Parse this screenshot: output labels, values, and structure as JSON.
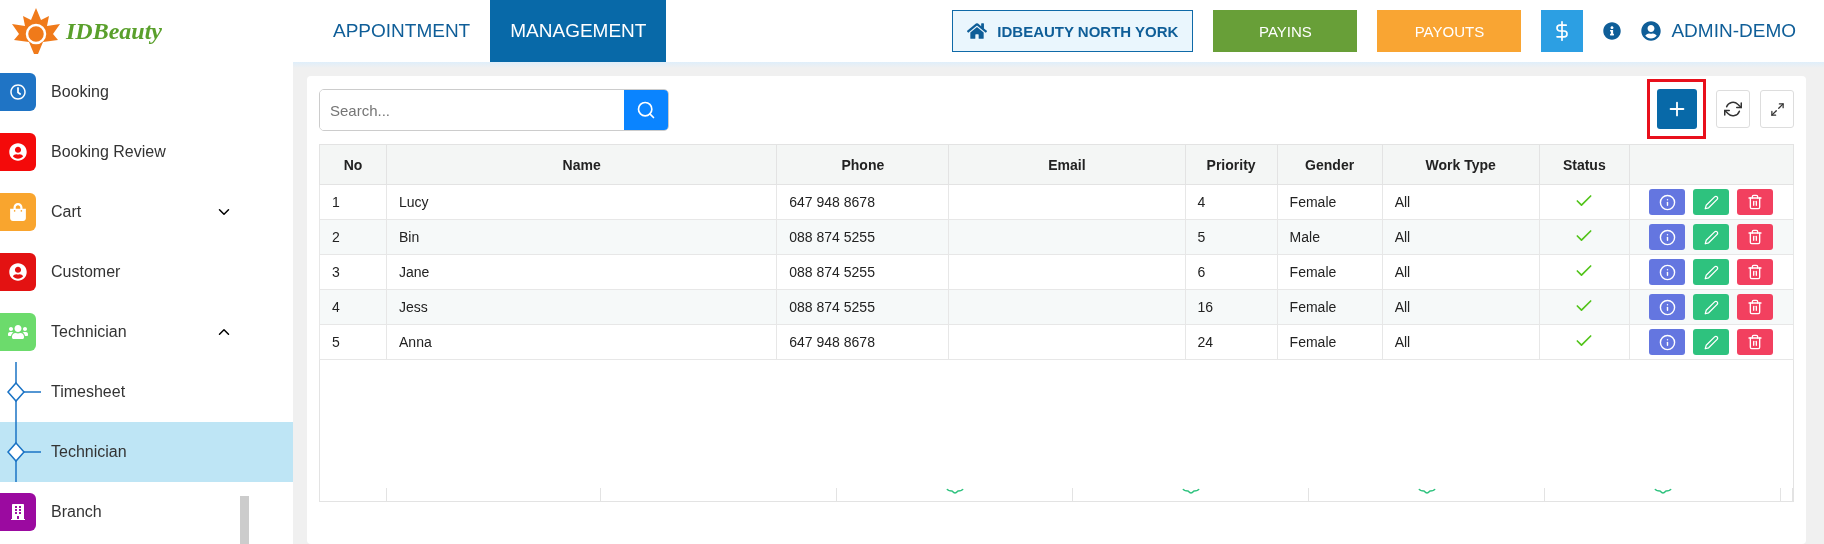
{
  "logo": {
    "text": "IDBeauty"
  },
  "nav_tabs": [
    {
      "label": "APPOINTMENT",
      "selected": false
    },
    {
      "label": "MANAGEMENT",
      "selected": true
    }
  ],
  "branch_button": "IDBEAUTY NORTH YORK",
  "action_buttons": [
    {
      "label": "PAYINS",
      "color": "#689f38"
    },
    {
      "label": "PAYOUTS",
      "color": "#f9a533"
    }
  ],
  "user": "ADMIN-DEMO",
  "sidebar": {
    "items": [
      {
        "label": "Booking",
        "color": "#1f74c5"
      },
      {
        "label": "Booking Review",
        "color": "#f40a0a"
      },
      {
        "label": "Cart",
        "color": "#f9a52e",
        "expanded": false
      },
      {
        "label": "Customer",
        "color": "#e31212"
      },
      {
        "label": "Technician",
        "color": "#6cdb6c",
        "expanded": true,
        "children": [
          {
            "label": "Timesheet",
            "selected": false
          },
          {
            "label": "Technician",
            "selected": true
          }
        ]
      },
      {
        "label": "Branch",
        "color": "#9b0aa0"
      }
    ]
  },
  "search": {
    "placeholder": "Search..."
  },
  "table": {
    "columns": [
      "No",
      "Name",
      "Phone",
      "Email",
      "Priority",
      "Gender",
      "Work Type",
      "Status"
    ],
    "rows": [
      {
        "no": "1",
        "name": "Lucy",
        "phone": "647 948 8678",
        "priority": "4",
        "gender": "Female",
        "work_type": "All",
        "status": true
      },
      {
        "no": "2",
        "name": "Bin",
        "phone": "088 874 5255",
        "priority": "5",
        "gender": "Male",
        "work_type": "All",
        "status": true
      },
      {
        "no": "3",
        "name": "Jane",
        "phone": "088 874 5255",
        "priority": "6",
        "gender": "Female",
        "work_type": "All",
        "status": true
      },
      {
        "no": "4",
        "name": "Jess",
        "phone": "088 874 5255",
        "priority": "16",
        "gender": "Female",
        "work_type": "All",
        "status": true
      },
      {
        "no": "5",
        "name": "Anna",
        "phone": "647 948 8678",
        "priority": "24",
        "gender": "Female",
        "work_type": "All",
        "status": true
      }
    ]
  }
}
